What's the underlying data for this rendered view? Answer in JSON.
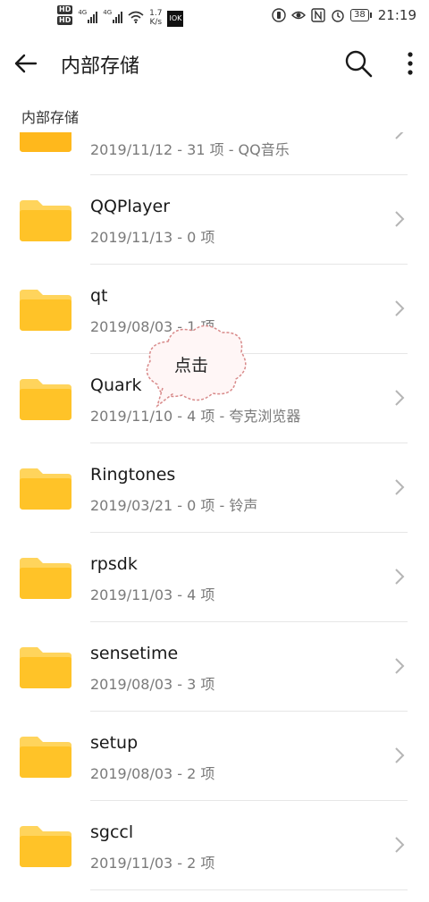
{
  "status_bar": {
    "hd1": "HD",
    "hd2": "HD",
    "net1": "4G",
    "net2": "4G",
    "speed_value": "1.7",
    "speed_unit": "K/s",
    "app_icon_text": "IOK",
    "battery": "38",
    "time": "21:19"
  },
  "app_bar": {
    "title": "内部存储"
  },
  "breadcrumb": "内部存储",
  "folders": [
    {
      "name": "",
      "meta": "2019/11/12 - 31 项 - QQ音乐"
    },
    {
      "name": "QQPlayer",
      "meta": "2019/11/13 - 0 项"
    },
    {
      "name": "qt",
      "meta": "2019/08/03 - 1 项"
    },
    {
      "name": "Quark",
      "meta": "2019/11/10 - 4 项 - 夸克浏览器"
    },
    {
      "name": "Ringtones",
      "meta": "2019/03/21 - 0 项 - 铃声"
    },
    {
      "name": "rpsdk",
      "meta": "2019/11/03 - 4 项"
    },
    {
      "name": "sensetime",
      "meta": "2019/08/03 - 3 项"
    },
    {
      "name": "setup",
      "meta": "2019/08/03 - 2 项"
    },
    {
      "name": "sgccl",
      "meta": "2019/11/03 - 2 项"
    }
  ],
  "annotation": "点击",
  "colors": {
    "folder": "#FFC328",
    "folder_tab": "#FFD45C",
    "meta_text": "#7a7a7a",
    "divider": "#e6e6e6"
  }
}
